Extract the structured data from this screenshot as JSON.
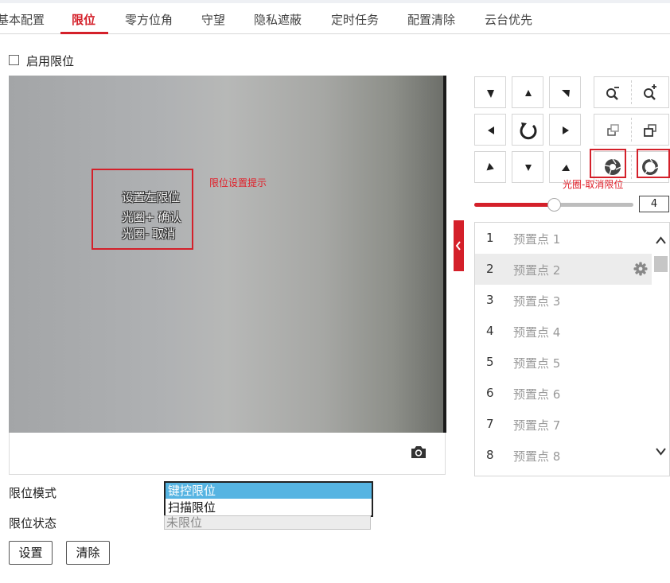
{
  "tabs": [
    {
      "label": "基本配置",
      "active": false
    },
    {
      "label": "限位",
      "active": true
    },
    {
      "label": "零方位角",
      "active": false
    },
    {
      "label": "守望",
      "active": false
    },
    {
      "label": "隐私遮蔽",
      "active": false
    },
    {
      "label": "定时任务",
      "active": false
    },
    {
      "label": "配置清除",
      "active": false
    },
    {
      "label": "云台优先",
      "active": false
    }
  ],
  "enable_limit": {
    "label": "启用限位",
    "checked": false
  },
  "video": {
    "osd_lines": [
      "设置左限位",
      "光圈+ 确认",
      "光圈- 取消"
    ],
    "hint_label": "限位设置提示",
    "snapshot_icon": "camera-icon"
  },
  "ptz": {
    "direction_icons": [
      "arrow-up-left",
      "arrow-up",
      "arrow-up-right",
      "arrow-left",
      "auto-rotate",
      "arrow-right",
      "arrow-down-left",
      "arrow-down",
      "arrow-down-right"
    ],
    "zoom_icons": [
      "zoom-out-icon",
      "zoom-in-icon"
    ],
    "focus_icons": [
      "focus-near-icon",
      "focus-far-icon"
    ],
    "iris_icons": [
      "iris-close-icon",
      "iris-open-icon"
    ],
    "iris_hint": "光圈-取消限位",
    "speed": {
      "value": "4",
      "level": 4,
      "max": 7
    }
  },
  "presets": [
    {
      "num": "1",
      "name": "预置点 1"
    },
    {
      "num": "2",
      "name": "预置点 2",
      "selected": true
    },
    {
      "num": "3",
      "name": "预置点 3"
    },
    {
      "num": "4",
      "name": "预置点 4"
    },
    {
      "num": "5",
      "name": "预置点 5"
    },
    {
      "num": "6",
      "name": "预置点 6"
    },
    {
      "num": "7",
      "name": "预置点 7"
    },
    {
      "num": "8",
      "name": "预置点 8"
    }
  ],
  "form": {
    "mode_label": "限位模式",
    "mode_options": [
      "键控限位",
      "扫描限位"
    ],
    "mode_selected": "键控限位",
    "status_label": "限位状态",
    "status_value": "未限位"
  },
  "buttons": {
    "set": "设置",
    "clear": "清除"
  },
  "colors": {
    "accent": "#d4202a",
    "selection": "#56b4e2",
    "slider_fill": "#d4202a",
    "slider_rest": "#bdbdbd"
  }
}
